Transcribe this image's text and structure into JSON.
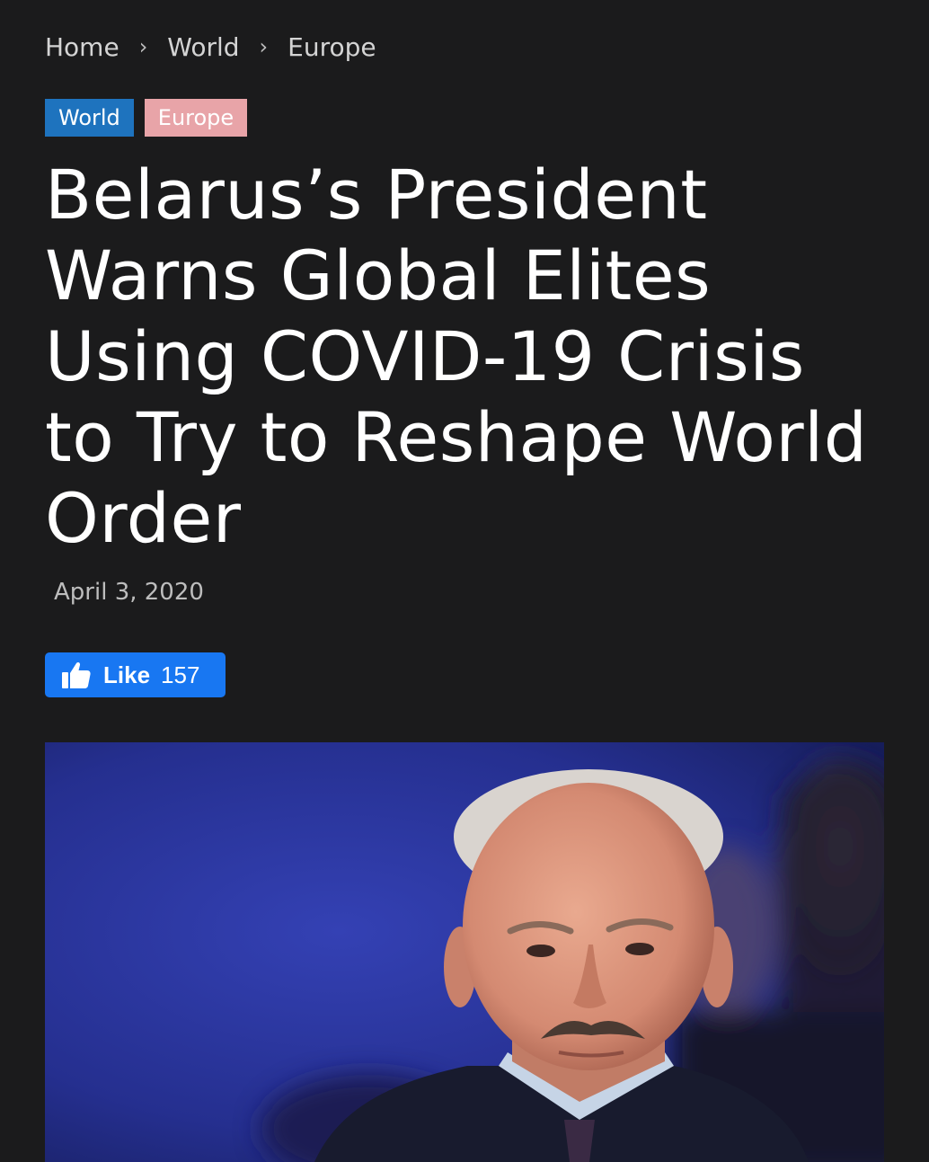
{
  "breadcrumb": {
    "items": [
      "Home",
      "World",
      "Europe"
    ],
    "separator": "›"
  },
  "tags": [
    {
      "label": "World",
      "color": "#1e73be"
    },
    {
      "label": "Europe",
      "color": "#e8a4a8"
    }
  ],
  "article": {
    "title": "Belarus’s President Warns Global Elites Using COVID-19 Crisis to Try to Reshape World Order",
    "date": "April 3, 2020"
  },
  "like_button": {
    "icon": "thumbs-up-icon",
    "label": "Like",
    "count": "157",
    "color": "#1877f2"
  },
  "colors": {
    "page_background": "#1b1b1c",
    "photo_background": "#2a3496"
  }
}
